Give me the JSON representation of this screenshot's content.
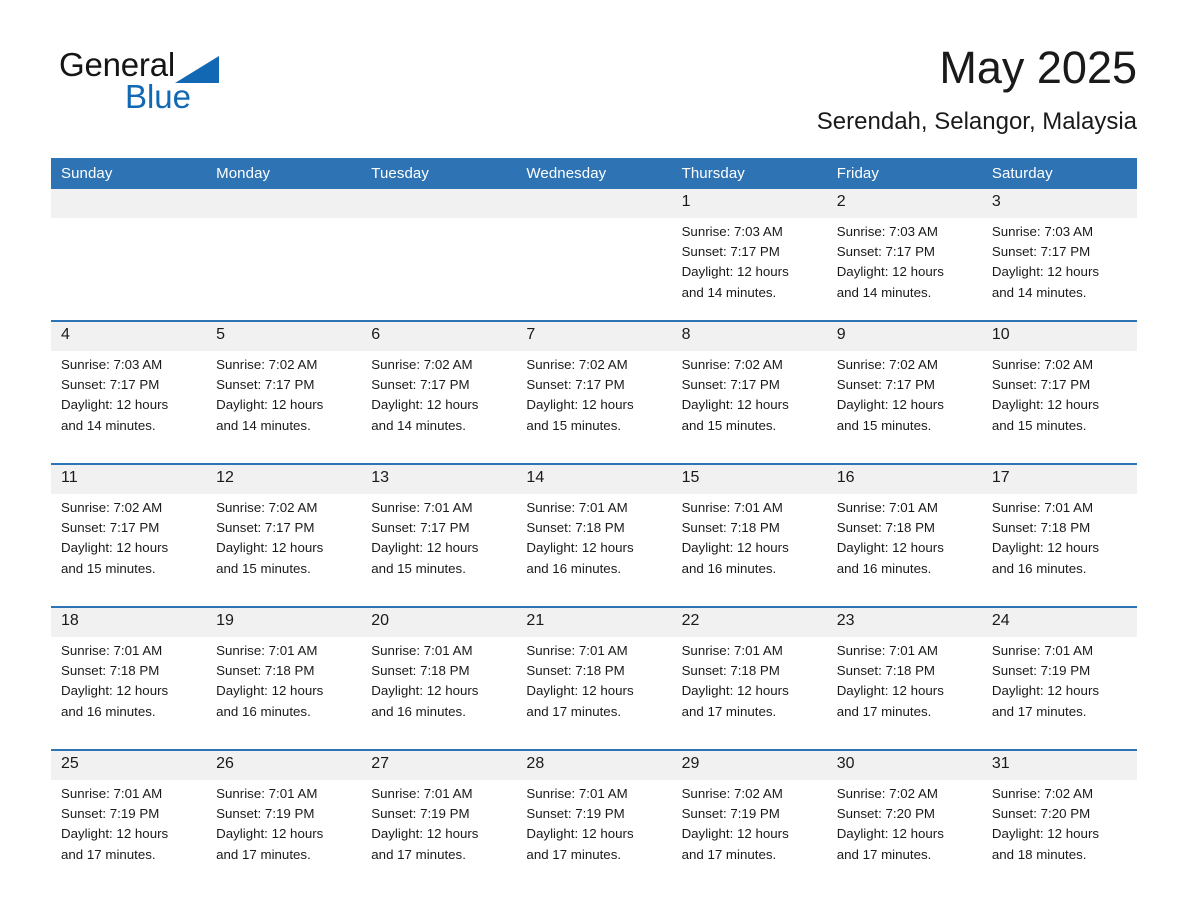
{
  "brand": {
    "name_part1": "General",
    "name_part2": "Blue",
    "triangle_color": "#1268b3",
    "text_color": "#151515"
  },
  "header": {
    "title": "May 2025",
    "subtitle": "Serendah, Selangor, Malaysia"
  },
  "theme": {
    "header_bg": "#2e74b5",
    "header_text": "#ffffff",
    "daynum_bg": "#f1f1f1",
    "separator": "#2e74b5",
    "cell_bg": "#ffffff"
  },
  "weekday_headers": [
    "Sunday",
    "Monday",
    "Tuesday",
    "Wednesday",
    "Thursday",
    "Friday",
    "Saturday"
  ],
  "weeks": [
    {
      "days": [
        {
          "num": "",
          "sunrise": "",
          "sunset": "",
          "daylight_1": "",
          "daylight_2": ""
        },
        {
          "num": "",
          "sunrise": "",
          "sunset": "",
          "daylight_1": "",
          "daylight_2": ""
        },
        {
          "num": "",
          "sunrise": "",
          "sunset": "",
          "daylight_1": "",
          "daylight_2": ""
        },
        {
          "num": "",
          "sunrise": "",
          "sunset": "",
          "daylight_1": "",
          "daylight_2": ""
        },
        {
          "num": "1",
          "sunrise": "Sunrise: 7:03 AM",
          "sunset": "Sunset: 7:17 PM",
          "daylight_1": "Daylight: 12 hours",
          "daylight_2": "and 14 minutes."
        },
        {
          "num": "2",
          "sunrise": "Sunrise: 7:03 AM",
          "sunset": "Sunset: 7:17 PM",
          "daylight_1": "Daylight: 12 hours",
          "daylight_2": "and 14 minutes."
        },
        {
          "num": "3",
          "sunrise": "Sunrise: 7:03 AM",
          "sunset": "Sunset: 7:17 PM",
          "daylight_1": "Daylight: 12 hours",
          "daylight_2": "and 14 minutes."
        }
      ]
    },
    {
      "days": [
        {
          "num": "4",
          "sunrise": "Sunrise: 7:03 AM",
          "sunset": "Sunset: 7:17 PM",
          "daylight_1": "Daylight: 12 hours",
          "daylight_2": "and 14 minutes."
        },
        {
          "num": "5",
          "sunrise": "Sunrise: 7:02 AM",
          "sunset": "Sunset: 7:17 PM",
          "daylight_1": "Daylight: 12 hours",
          "daylight_2": "and 14 minutes."
        },
        {
          "num": "6",
          "sunrise": "Sunrise: 7:02 AM",
          "sunset": "Sunset: 7:17 PM",
          "daylight_1": "Daylight: 12 hours",
          "daylight_2": "and 14 minutes."
        },
        {
          "num": "7",
          "sunrise": "Sunrise: 7:02 AM",
          "sunset": "Sunset: 7:17 PM",
          "daylight_1": "Daylight: 12 hours",
          "daylight_2": "and 15 minutes."
        },
        {
          "num": "8",
          "sunrise": "Sunrise: 7:02 AM",
          "sunset": "Sunset: 7:17 PM",
          "daylight_1": "Daylight: 12 hours",
          "daylight_2": "and 15 minutes."
        },
        {
          "num": "9",
          "sunrise": "Sunrise: 7:02 AM",
          "sunset": "Sunset: 7:17 PM",
          "daylight_1": "Daylight: 12 hours",
          "daylight_2": "and 15 minutes."
        },
        {
          "num": "10",
          "sunrise": "Sunrise: 7:02 AM",
          "sunset": "Sunset: 7:17 PM",
          "daylight_1": "Daylight: 12 hours",
          "daylight_2": "and 15 minutes."
        }
      ]
    },
    {
      "days": [
        {
          "num": "11",
          "sunrise": "Sunrise: 7:02 AM",
          "sunset": "Sunset: 7:17 PM",
          "daylight_1": "Daylight: 12 hours",
          "daylight_2": "and 15 minutes."
        },
        {
          "num": "12",
          "sunrise": "Sunrise: 7:02 AM",
          "sunset": "Sunset: 7:17 PM",
          "daylight_1": "Daylight: 12 hours",
          "daylight_2": "and 15 minutes."
        },
        {
          "num": "13",
          "sunrise": "Sunrise: 7:01 AM",
          "sunset": "Sunset: 7:17 PM",
          "daylight_1": "Daylight: 12 hours",
          "daylight_2": "and 15 minutes."
        },
        {
          "num": "14",
          "sunrise": "Sunrise: 7:01 AM",
          "sunset": "Sunset: 7:18 PM",
          "daylight_1": "Daylight: 12 hours",
          "daylight_2": "and 16 minutes."
        },
        {
          "num": "15",
          "sunrise": "Sunrise: 7:01 AM",
          "sunset": "Sunset: 7:18 PM",
          "daylight_1": "Daylight: 12 hours",
          "daylight_2": "and 16 minutes."
        },
        {
          "num": "16",
          "sunrise": "Sunrise: 7:01 AM",
          "sunset": "Sunset: 7:18 PM",
          "daylight_1": "Daylight: 12 hours",
          "daylight_2": "and 16 minutes."
        },
        {
          "num": "17",
          "sunrise": "Sunrise: 7:01 AM",
          "sunset": "Sunset: 7:18 PM",
          "daylight_1": "Daylight: 12 hours",
          "daylight_2": "and 16 minutes."
        }
      ]
    },
    {
      "days": [
        {
          "num": "18",
          "sunrise": "Sunrise: 7:01 AM",
          "sunset": "Sunset: 7:18 PM",
          "daylight_1": "Daylight: 12 hours",
          "daylight_2": "and 16 minutes."
        },
        {
          "num": "19",
          "sunrise": "Sunrise: 7:01 AM",
          "sunset": "Sunset: 7:18 PM",
          "daylight_1": "Daylight: 12 hours",
          "daylight_2": "and 16 minutes."
        },
        {
          "num": "20",
          "sunrise": "Sunrise: 7:01 AM",
          "sunset": "Sunset: 7:18 PM",
          "daylight_1": "Daylight: 12 hours",
          "daylight_2": "and 16 minutes."
        },
        {
          "num": "21",
          "sunrise": "Sunrise: 7:01 AM",
          "sunset": "Sunset: 7:18 PM",
          "daylight_1": "Daylight: 12 hours",
          "daylight_2": "and 17 minutes."
        },
        {
          "num": "22",
          "sunrise": "Sunrise: 7:01 AM",
          "sunset": "Sunset: 7:18 PM",
          "daylight_1": "Daylight: 12 hours",
          "daylight_2": "and 17 minutes."
        },
        {
          "num": "23",
          "sunrise": "Sunrise: 7:01 AM",
          "sunset": "Sunset: 7:18 PM",
          "daylight_1": "Daylight: 12 hours",
          "daylight_2": "and 17 minutes."
        },
        {
          "num": "24",
          "sunrise": "Sunrise: 7:01 AM",
          "sunset": "Sunset: 7:19 PM",
          "daylight_1": "Daylight: 12 hours",
          "daylight_2": "and 17 minutes."
        }
      ]
    },
    {
      "days": [
        {
          "num": "25",
          "sunrise": "Sunrise: 7:01 AM",
          "sunset": "Sunset: 7:19 PM",
          "daylight_1": "Daylight: 12 hours",
          "daylight_2": "and 17 minutes."
        },
        {
          "num": "26",
          "sunrise": "Sunrise: 7:01 AM",
          "sunset": "Sunset: 7:19 PM",
          "daylight_1": "Daylight: 12 hours",
          "daylight_2": "and 17 minutes."
        },
        {
          "num": "27",
          "sunrise": "Sunrise: 7:01 AM",
          "sunset": "Sunset: 7:19 PM",
          "daylight_1": "Daylight: 12 hours",
          "daylight_2": "and 17 minutes."
        },
        {
          "num": "28",
          "sunrise": "Sunrise: 7:01 AM",
          "sunset": "Sunset: 7:19 PM",
          "daylight_1": "Daylight: 12 hours",
          "daylight_2": "and 17 minutes."
        },
        {
          "num": "29",
          "sunrise": "Sunrise: 7:02 AM",
          "sunset": "Sunset: 7:19 PM",
          "daylight_1": "Daylight: 12 hours",
          "daylight_2": "and 17 minutes."
        },
        {
          "num": "30",
          "sunrise": "Sunrise: 7:02 AM",
          "sunset": "Sunset: 7:20 PM",
          "daylight_1": "Daylight: 12 hours",
          "daylight_2": "and 17 minutes."
        },
        {
          "num": "31",
          "sunrise": "Sunrise: 7:02 AM",
          "sunset": "Sunset: 7:20 PM",
          "daylight_1": "Daylight: 12 hours",
          "daylight_2": "and 18 minutes."
        }
      ]
    }
  ]
}
